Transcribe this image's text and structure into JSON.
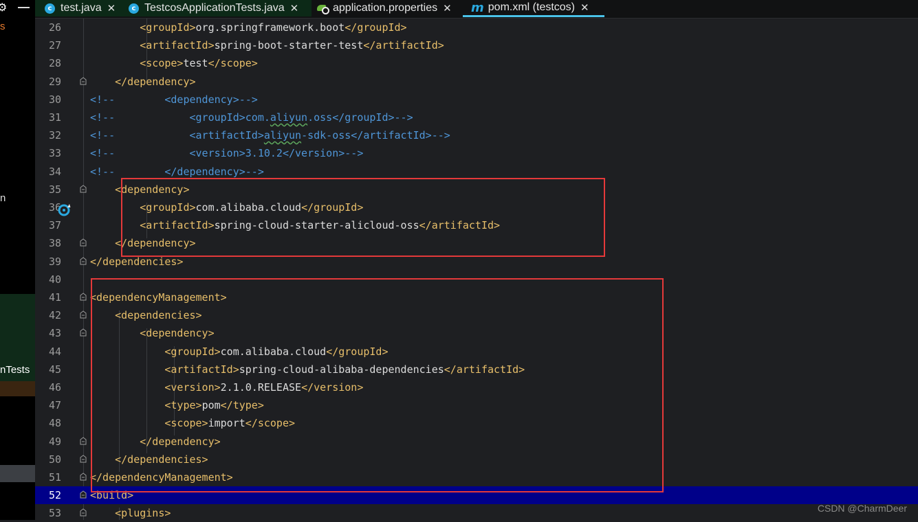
{
  "sidebar": {
    "frag_top": "s",
    "frag_mid": "n",
    "frag_tests": "nTests"
  },
  "tabs": [
    {
      "label": "test.java",
      "icon": "java-class-icon",
      "close": "✕"
    },
    {
      "label": "TestcosApplicationTests.java",
      "icon": "java-test-class-icon",
      "close": "✕"
    },
    {
      "label": "application.properties",
      "icon": "spring-properties-icon",
      "close": "✕"
    },
    {
      "label": "pom.xml (testcos)",
      "icon": "maven-icon",
      "close": "✕"
    }
  ],
  "editor": {
    "current_line": "52",
    "lines": [
      {
        "n": "26",
        "tokens": [
          {
            "t": "        "
          },
          {
            "t": "<groupId>",
            "c": "t"
          },
          {
            "t": "org.springframework.boot"
          },
          {
            "t": "</groupId>",
            "c": "t"
          }
        ]
      },
      {
        "n": "27",
        "tokens": [
          {
            "t": "        "
          },
          {
            "t": "<artifactId>",
            "c": "t"
          },
          {
            "t": "spring-boot-starter-test"
          },
          {
            "t": "</artifactId>",
            "c": "t"
          }
        ]
      },
      {
        "n": "28",
        "tokens": [
          {
            "t": "        "
          },
          {
            "t": "<scope>",
            "c": "t"
          },
          {
            "t": "test"
          },
          {
            "t": "</scope>",
            "c": "t"
          }
        ]
      },
      {
        "n": "29",
        "tokens": [
          {
            "t": "    "
          },
          {
            "t": "</dependency>",
            "c": "t"
          }
        ]
      },
      {
        "n": "30",
        "tokens": [
          {
            "t": "<!--        <dependency>-->",
            "c": "cm"
          }
        ]
      },
      {
        "n": "31",
        "tokens": [
          {
            "t": "<!--            <groupId>com.",
            "c": "cm"
          },
          {
            "t": "aliyun",
            "c": "cm sq"
          },
          {
            "t": ".oss</groupId>-->",
            "c": "cm"
          }
        ]
      },
      {
        "n": "32",
        "tokens": [
          {
            "t": "<!--            <artifactId>",
            "c": "cm"
          },
          {
            "t": "aliyun",
            "c": "cm sq"
          },
          {
            "t": "-sdk-oss</artifactId>-->",
            "c": "cm"
          }
        ]
      },
      {
        "n": "33",
        "tokens": [
          {
            "t": "<!--            <version>3.10.2</version>-->",
            "c": "cm"
          }
        ]
      },
      {
        "n": "34",
        "tokens": [
          {
            "t": "<!--        </dependency>-->",
            "c": "cm"
          }
        ]
      },
      {
        "n": "35",
        "tokens": [
          {
            "t": "    "
          },
          {
            "t": "<dependency>",
            "c": "t"
          }
        ]
      },
      {
        "n": "36",
        "tokens": [
          {
            "t": "        "
          },
          {
            "t": "<groupId>",
            "c": "t"
          },
          {
            "t": "com.alibaba.cloud"
          },
          {
            "t": "</groupId>",
            "c": "t"
          }
        ]
      },
      {
        "n": "37",
        "tokens": [
          {
            "t": "        "
          },
          {
            "t": "<artifactId>",
            "c": "t"
          },
          {
            "t": "spring-cloud-starter-alicloud-oss"
          },
          {
            "t": "</artifactId>",
            "c": "t"
          }
        ]
      },
      {
        "n": "38",
        "tokens": [
          {
            "t": "    "
          },
          {
            "t": "</dependency>",
            "c": "t"
          }
        ]
      },
      {
        "n": "39",
        "tokens": [
          {
            "t": "</dependencies>",
            "c": "t"
          }
        ]
      },
      {
        "n": "40",
        "tokens": []
      },
      {
        "n": "41",
        "tokens": [
          {
            "t": "<dependencyManagement>",
            "c": "t"
          }
        ]
      },
      {
        "n": "42",
        "tokens": [
          {
            "t": "    "
          },
          {
            "t": "<dependencies>",
            "c": "t"
          }
        ]
      },
      {
        "n": "43",
        "tokens": [
          {
            "t": "        "
          },
          {
            "t": "<dependency>",
            "c": "t"
          }
        ]
      },
      {
        "n": "44",
        "tokens": [
          {
            "t": "            "
          },
          {
            "t": "<groupId>",
            "c": "t"
          },
          {
            "t": "com.alibaba.cloud"
          },
          {
            "t": "</groupId>",
            "c": "t"
          }
        ]
      },
      {
        "n": "45",
        "tokens": [
          {
            "t": "            "
          },
          {
            "t": "<artifactId>",
            "c": "t"
          },
          {
            "t": "spring-cloud-alibaba-dependencies"
          },
          {
            "t": "</artifactId>",
            "c": "t"
          }
        ]
      },
      {
        "n": "46",
        "tokens": [
          {
            "t": "            "
          },
          {
            "t": "<version>",
            "c": "t"
          },
          {
            "t": "2.1.0.RELEASE"
          },
          {
            "t": "</version>",
            "c": "t"
          }
        ]
      },
      {
        "n": "47",
        "tokens": [
          {
            "t": "            "
          },
          {
            "t": "<type>",
            "c": "t"
          },
          {
            "t": "pom"
          },
          {
            "t": "</type>",
            "c": "t"
          }
        ]
      },
      {
        "n": "48",
        "tokens": [
          {
            "t": "            "
          },
          {
            "t": "<scope>",
            "c": "t"
          },
          {
            "t": "import"
          },
          {
            "t": "</scope>",
            "c": "t"
          }
        ]
      },
      {
        "n": "49",
        "tokens": [
          {
            "t": "        "
          },
          {
            "t": "</dependency>",
            "c": "t"
          }
        ]
      },
      {
        "n": "50",
        "tokens": [
          {
            "t": "    "
          },
          {
            "t": "</dependencies>",
            "c": "t"
          }
        ]
      },
      {
        "n": "51",
        "tokens": [
          {
            "t": "</dependencyManagement>",
            "c": "t"
          }
        ]
      },
      {
        "n": "52",
        "tokens": [
          {
            "t": "<build>",
            "c": "t"
          }
        ]
      },
      {
        "n": "53",
        "tokens": [
          {
            "t": "    "
          },
          {
            "t": "<plugins>",
            "c": "t"
          }
        ]
      }
    ]
  },
  "watermark": "CSDN @CharmDeer",
  "colors": {
    "tag": "#e8bf6a",
    "comment": "#4f96d8",
    "text": "#dcdcdc",
    "highlight_box": "#e5393a",
    "current_line_bg": "#000089",
    "tab_accent": "#4ac2e8"
  }
}
